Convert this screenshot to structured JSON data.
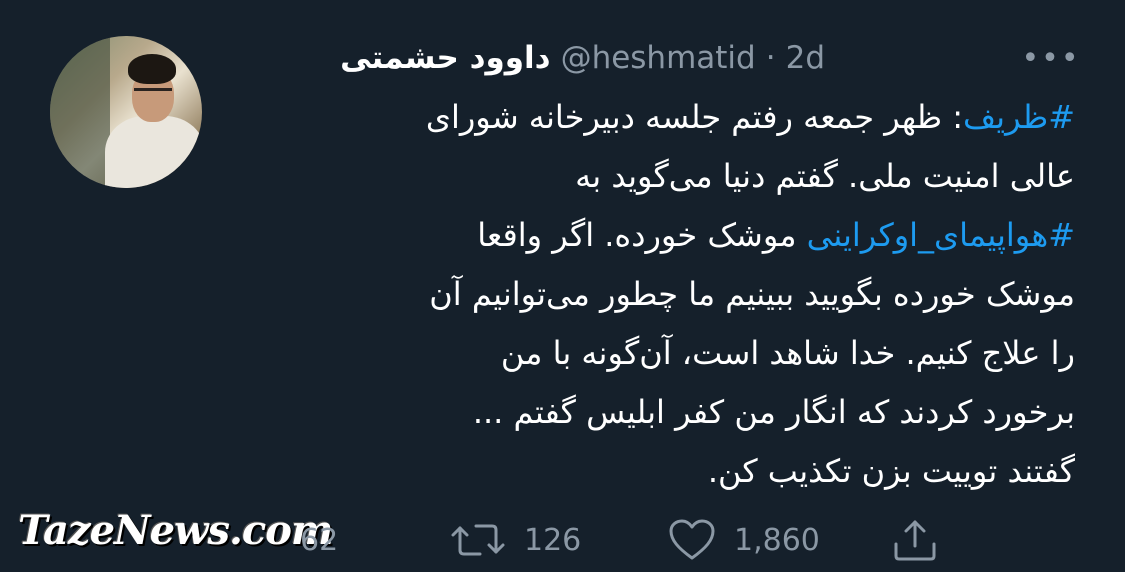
{
  "tweet": {
    "author": {
      "display_name": "داوود حشمتی",
      "handle": "@heshmatid",
      "separator": "·",
      "time": "2d"
    },
    "more_icon": "more-horizontal-icon",
    "lines": [
      {
        "hashtag": "#ظریف",
        "text": ": ظهر جمعه رفتم جلسه دبیرخانه شورای"
      },
      {
        "hashtag": "",
        "text": "عالی امنیت ملی. گفتم دنیا می‌گوید به"
      },
      {
        "hashtag": "#هواپیمای_اوکراینی",
        "text": " موشک خورده. اگر واقعا"
      },
      {
        "hashtag": "",
        "text": "موشک خورده بگویید ببینیم ما چطور می‌توانیم آن"
      },
      {
        "hashtag": "",
        "text": "را علاج کنیم. خدا شاهد است، آن‌گونه با من"
      },
      {
        "hashtag": "",
        "text": "برخورد کردند که انگار من کفر ابلیس گفتم ..."
      },
      {
        "hashtag": "",
        "text": "گفتند توییت بزن تکذیب کن."
      }
    ],
    "hashtag_color": "#1d9bf0",
    "actions": {
      "reply_count": "62",
      "retweet_count": "126",
      "like_count": "1,860"
    }
  },
  "watermark": "TazeNews.com",
  "colors": {
    "background": "#15202b",
    "secondary_text": "#8b98a5",
    "primary_text": "#ffffff"
  }
}
